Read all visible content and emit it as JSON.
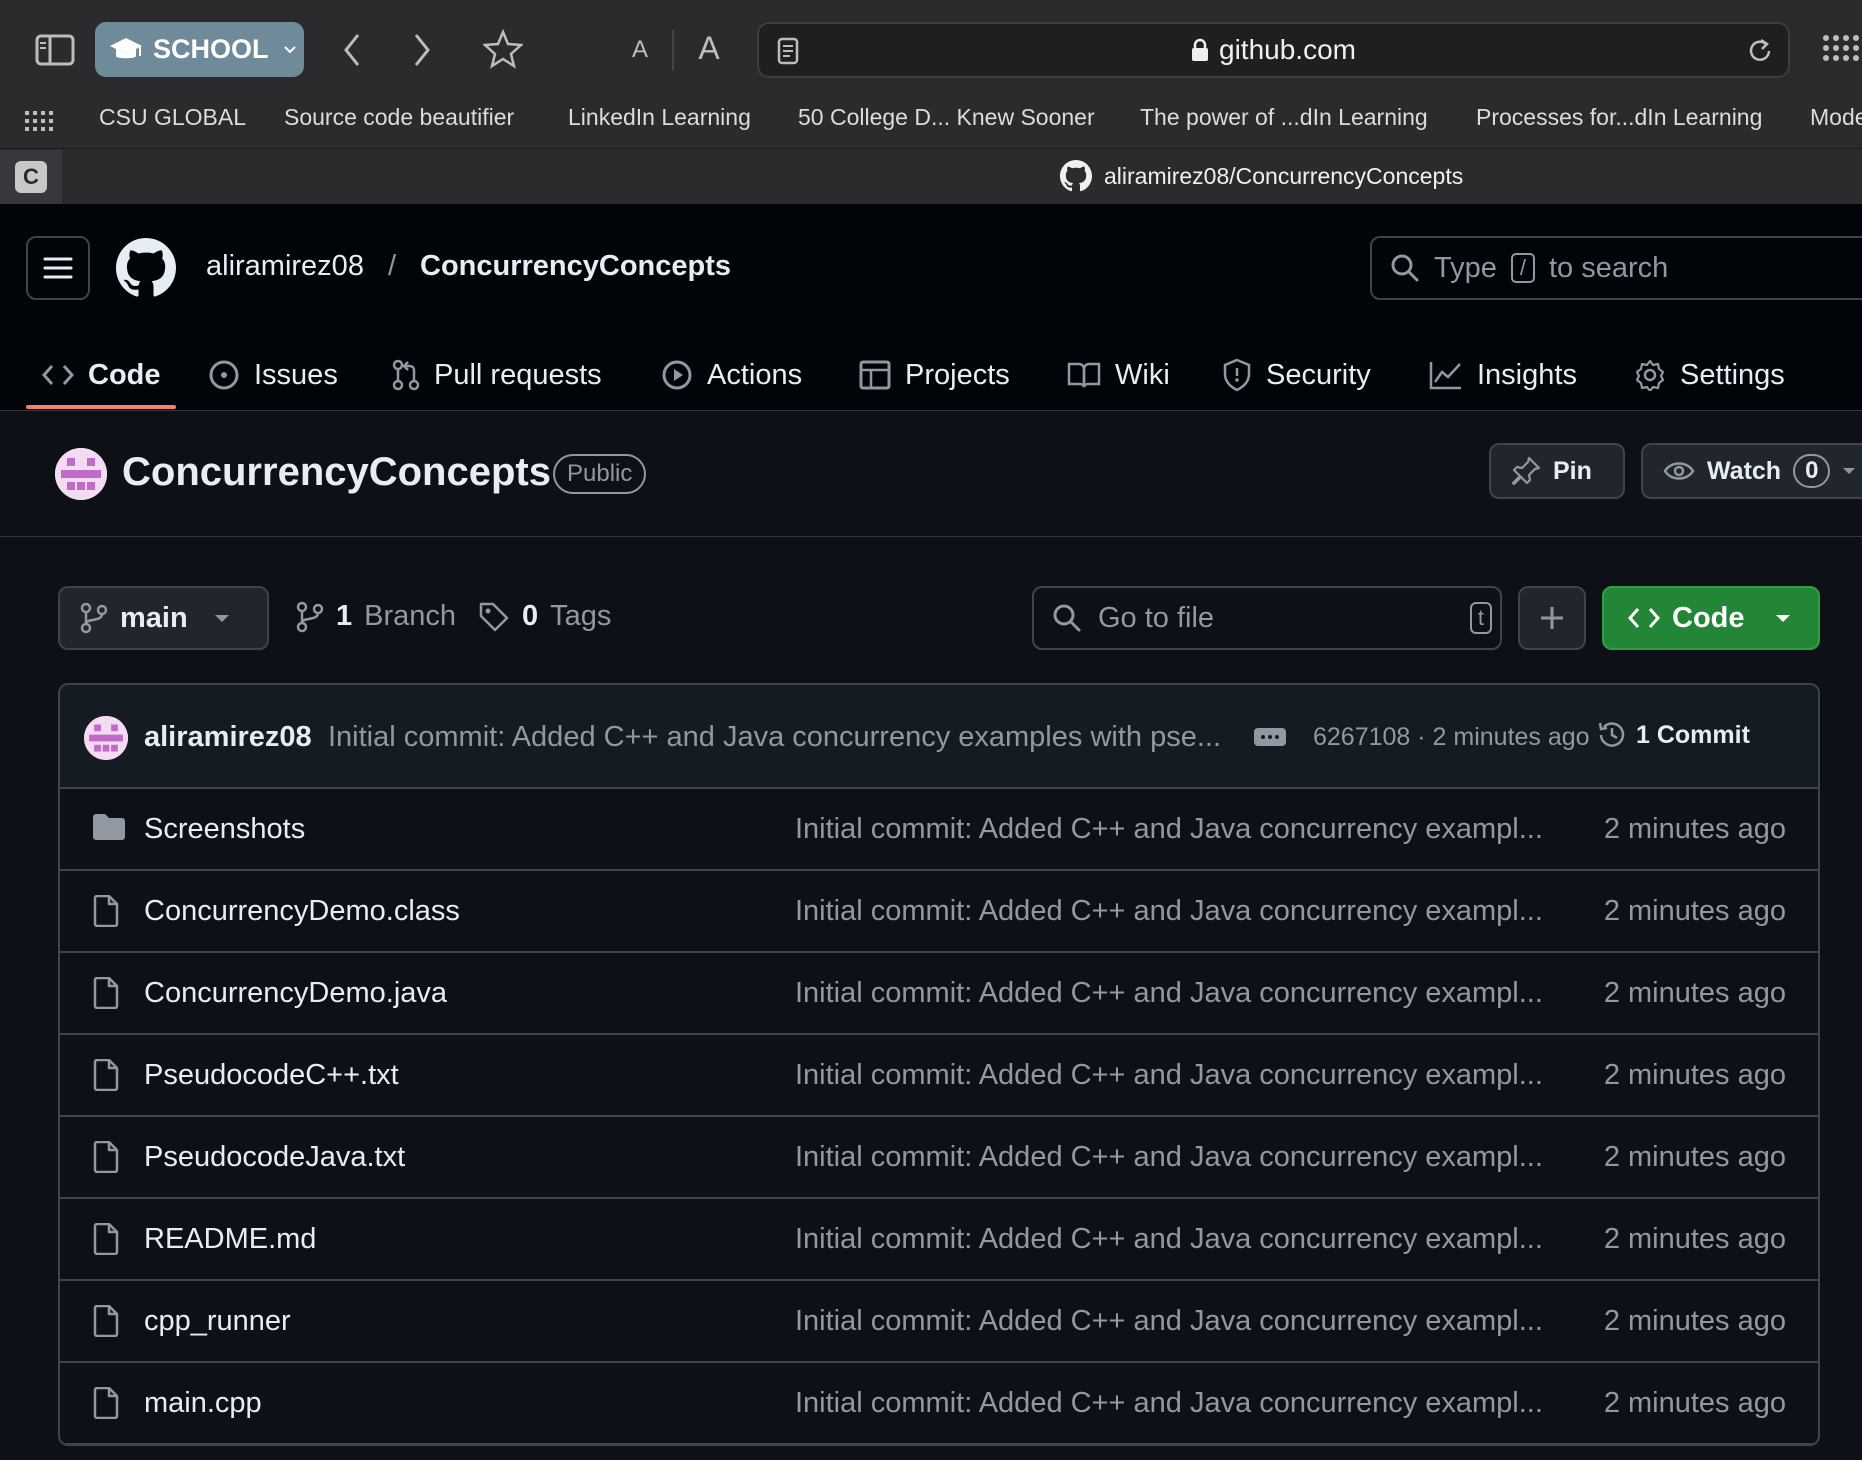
{
  "browser": {
    "profile_label": "SCHOOL",
    "font_small_label": "A",
    "font_large_label": "A",
    "url": "github.com",
    "bookmarks": [
      "CSU GLOBAL",
      "Source code beautifier",
      "LinkedIn Learning",
      "50 College D... Knew Sooner",
      "The power of ...dIn Learning",
      "Processes for...dIn Learning",
      "Mode"
    ],
    "tab_c_label": "C",
    "active_tab_title": "aliramirez08/ConcurrencyConcepts"
  },
  "header": {
    "owner": "aliramirez08",
    "separator": "/",
    "repo": "ConcurrencyConcepts",
    "search_prefix": "Type",
    "search_key": "/",
    "search_suffix": "to search"
  },
  "nav": {
    "tabs": [
      {
        "label": "Code",
        "icon": "code-icon"
      },
      {
        "label": "Issues",
        "icon": "issue-icon"
      },
      {
        "label": "Pull requests",
        "icon": "pull-request-icon"
      },
      {
        "label": "Actions",
        "icon": "play-icon"
      },
      {
        "label": "Projects",
        "icon": "table-icon"
      },
      {
        "label": "Wiki",
        "icon": "book-icon"
      },
      {
        "label": "Security",
        "icon": "shield-icon"
      },
      {
        "label": "Insights",
        "icon": "graph-icon"
      },
      {
        "label": "Settings",
        "icon": "gear-icon"
      }
    ]
  },
  "repo": {
    "name": "ConcurrencyConcepts",
    "visibility": "Public",
    "pin_label": "Pin",
    "watch_label": "Watch",
    "watch_count": "0"
  },
  "toolbar": {
    "branch": "main",
    "branch_count": "1",
    "branch_word": "Branch",
    "tag_count": "0",
    "tag_word": "Tags",
    "goto_placeholder": "Go to file",
    "goto_key": "t",
    "code_label": "Code"
  },
  "commit": {
    "author": "aliramirez08",
    "message": "Initial commit: Added C++ and Java concurrency examples with pse...",
    "meta": "6267108 · 2 minutes ago",
    "count_label": "1 Commit"
  },
  "files": [
    {
      "name": "Screenshots",
      "type": "folder",
      "message": "Initial commit: Added C++ and Java concurrency exampl...",
      "time": "2 minutes ago"
    },
    {
      "name": "ConcurrencyDemo.class",
      "type": "file",
      "message": "Initial commit: Added C++ and Java concurrency exampl...",
      "time": "2 minutes ago"
    },
    {
      "name": "ConcurrencyDemo.java",
      "type": "file",
      "message": "Initial commit: Added C++ and Java concurrency exampl...",
      "time": "2 minutes ago"
    },
    {
      "name": "PseudocodeC++.txt",
      "type": "file",
      "message": "Initial commit: Added C++ and Java concurrency exampl...",
      "time": "2 minutes ago"
    },
    {
      "name": "PseudocodeJava.txt",
      "type": "file",
      "message": "Initial commit: Added C++ and Java concurrency exampl...",
      "time": "2 minutes ago"
    },
    {
      "name": "README.md",
      "type": "file",
      "message": "Initial commit: Added C++ and Java concurrency exampl...",
      "time": "2 minutes ago"
    },
    {
      "name": "cpp_runner",
      "type": "file",
      "message": "Initial commit: Added C++ and Java concurrency exampl...",
      "time": "2 minutes ago"
    },
    {
      "name": "main.cpp",
      "type": "file",
      "message": "Initial commit: Added C++ and Java concurrency exampl...",
      "time": "2 minutes ago"
    }
  ],
  "colors": {
    "page_bg": "#0d1117",
    "header_bg": "#010409",
    "accent_underline": "#f78166",
    "code_button": "#238636",
    "muted_text": "#9198a1"
  }
}
